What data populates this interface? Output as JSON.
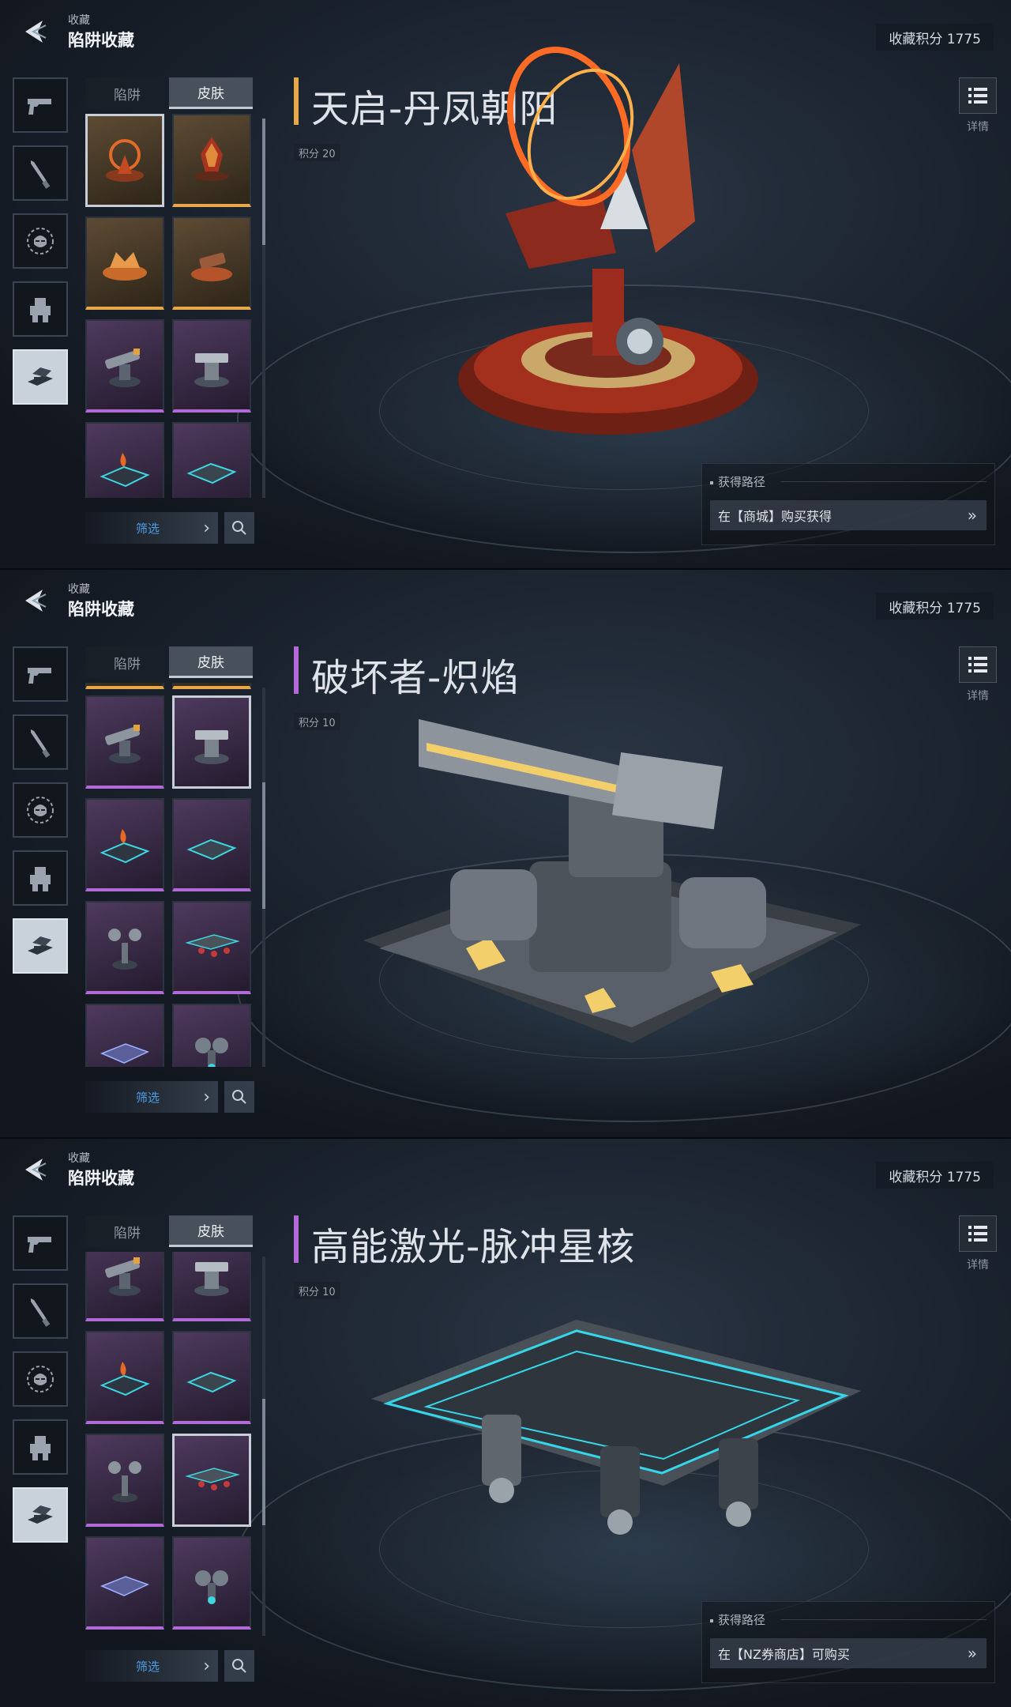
{
  "header": {
    "back_label": "收藏",
    "title": "陷阱收藏",
    "score": "收藏积分 1775"
  },
  "tabs": {
    "trap": "陷阱",
    "skin": "皮肤"
  },
  "filter_label": "筛选",
  "detail_label": "详情",
  "acquisition_heading": "获得路径",
  "categories": [
    "pistol-icon",
    "knife-icon",
    "mask-icon",
    "mech-icon",
    "trap-icon"
  ],
  "colors": {
    "gold_rarity": "#e6a84a",
    "purple_rarity": "#b16ad8",
    "filter_text": "#4e9ee8"
  },
  "panels": [
    {
      "title": "天启-丹凤朝阳",
      "points": "积分 20",
      "title_accent": "#e6a84a",
      "acquisition": "在【商城】购买获得"
    },
    {
      "title": "破坏者-炽焰",
      "points": "积分 10",
      "title_accent": "#b16ad8"
    },
    {
      "title": "高能激光-脉冲星核",
      "points": "积分 10",
      "title_accent": "#b16ad8",
      "acquisition": "在【NZ券商店】可购买"
    }
  ]
}
